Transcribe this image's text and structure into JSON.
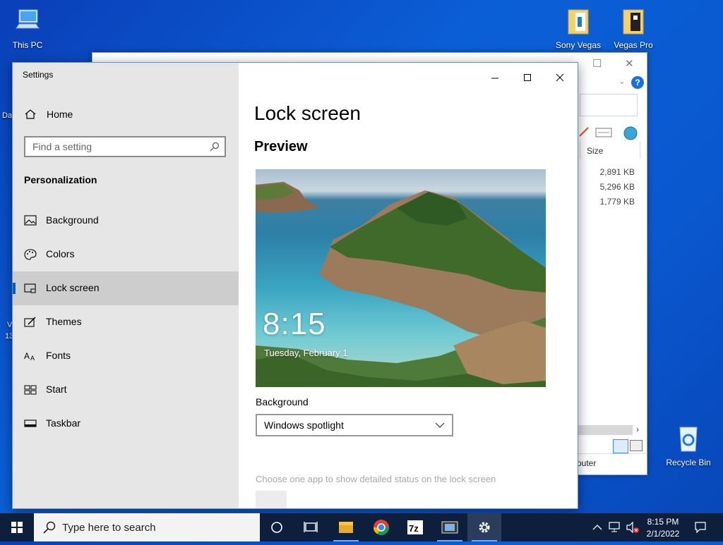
{
  "desktop": {
    "icons": [
      {
        "label": "This PC"
      },
      {
        "label": "Sony Vegas"
      },
      {
        "label": "Vegas Pro"
      },
      {
        "label": "Recycle Bin"
      }
    ],
    "edge_text": [
      "Da",
      "V",
      "13"
    ]
  },
  "explorer": {
    "column_size": "Size",
    "sizes": [
      "2,891 KB",
      "5,296 KB",
      "1,779 KB"
    ],
    "status": "outer"
  },
  "settings": {
    "window_title": "Settings",
    "home_label": "Home",
    "search_placeholder": "Find a setting",
    "section_title": "Personalization",
    "nav": [
      {
        "label": "Background",
        "icon": "picture-icon"
      },
      {
        "label": "Colors",
        "icon": "palette-icon"
      },
      {
        "label": "Lock screen",
        "icon": "lock-screen-icon",
        "selected": true
      },
      {
        "label": "Themes",
        "icon": "brush-icon"
      },
      {
        "label": "Fonts",
        "icon": "fonts-icon"
      },
      {
        "label": "Start",
        "icon": "start-icon"
      },
      {
        "label": "Taskbar",
        "icon": "taskbar-icon"
      }
    ],
    "page_title": "Lock screen",
    "preview_heading": "Preview",
    "preview_time": "8:15",
    "preview_date": "Tuesday, February 1",
    "background_label": "Background",
    "background_value": "Windows spotlight",
    "status_hint": "Choose one app to show detailed status on the lock screen",
    "accent": "#0063b1"
  },
  "taskbar": {
    "search_placeholder": "Type here to search",
    "time": "8:15 PM",
    "date": "2/1/2022"
  }
}
